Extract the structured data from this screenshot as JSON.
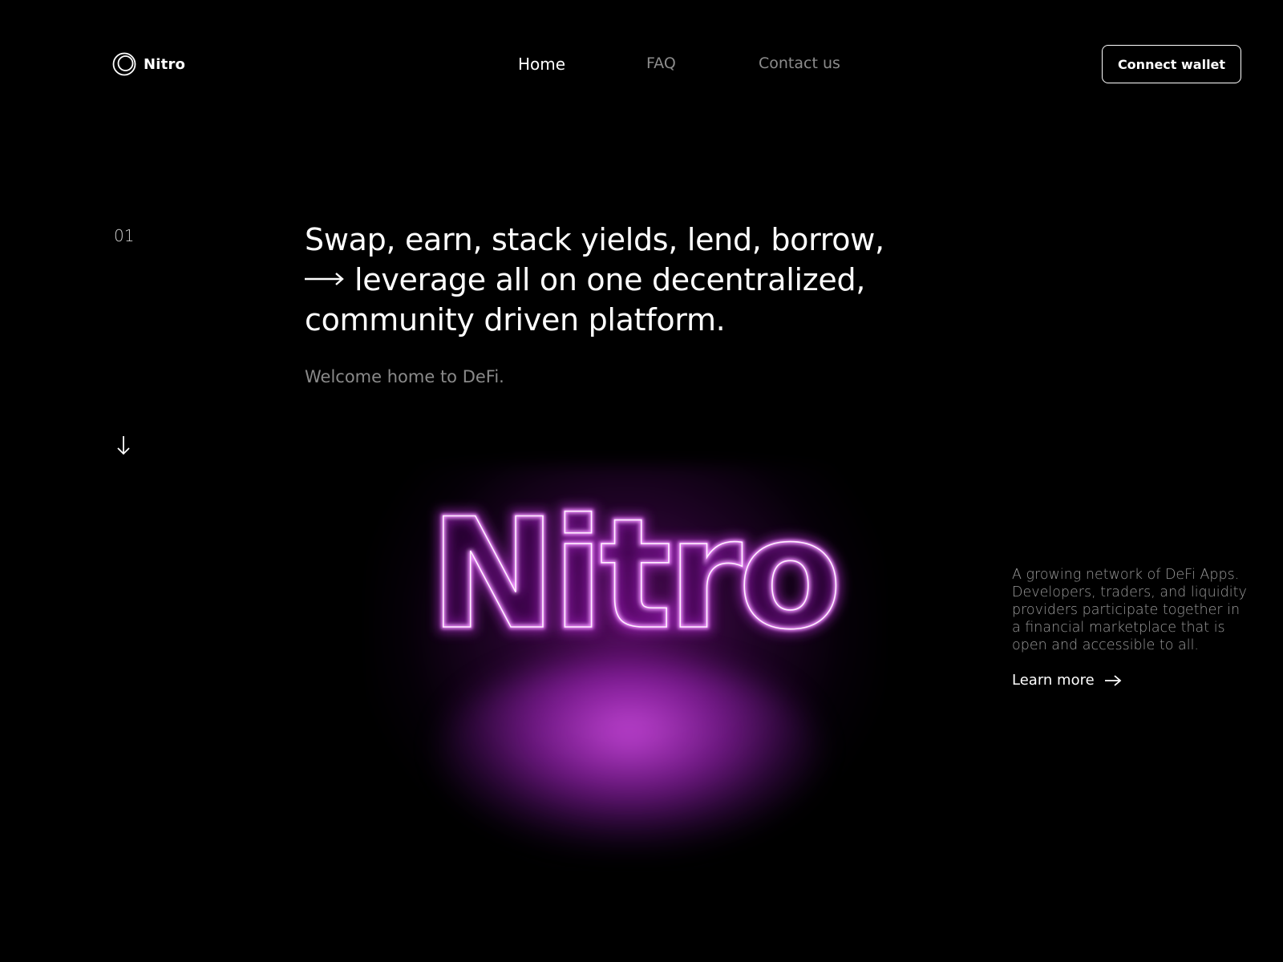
{
  "brand": {
    "name": "Nitro",
    "logo_icon": "double-ring-icon"
  },
  "nav": {
    "items": [
      {
        "label": "Home",
        "active": true
      },
      {
        "label": "FAQ",
        "active": false
      },
      {
        "label": "Contact us",
        "active": false
      }
    ]
  },
  "header": {
    "connect_label": "Connect wallet"
  },
  "hero": {
    "section_number": "01",
    "title_lines": [
      "Swap, earn, stack yields, lend, borrow,",
      "leverage all on one decentralized,",
      "community driven platform."
    ],
    "subtitle": "Welcome home to DeFi.",
    "neon_text": "Nitro"
  },
  "side": {
    "description": "A growing network of DeFi Apps. Developers, traders, and liquidity providers participate together in a financial marketplace that is open and accessible to all.",
    "learn_more_label": "Learn more"
  },
  "colors": {
    "background": "#000000",
    "text": "#ffffff",
    "muted": "#8c8c8c",
    "neon": "#e070ff",
    "neon_glow": "#b020d0"
  }
}
